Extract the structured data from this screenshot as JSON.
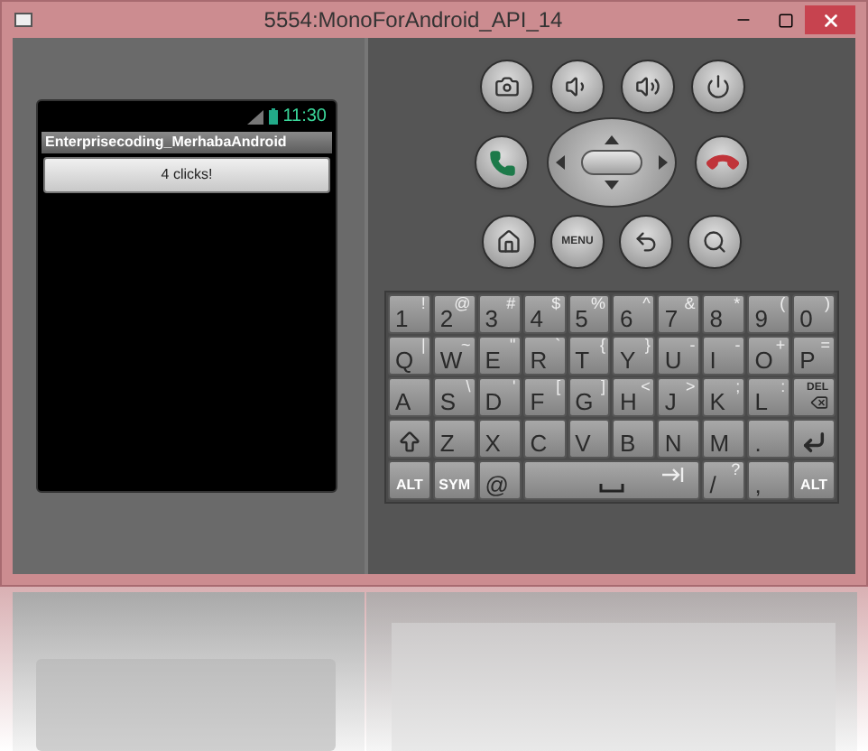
{
  "window": {
    "title": "5554:MonoForAndroid_API_14"
  },
  "phone": {
    "status_time": "11:30",
    "app_title": "Enterprisecoding_MerhabaAndroid",
    "button": "4 clicks!"
  },
  "hardware": {
    "menu_label": "MENU"
  },
  "keyboard": {
    "rows": [
      [
        {
          "kind": "char",
          "label": "1",
          "alt": "!"
        },
        {
          "kind": "char",
          "label": "2",
          "alt": "@"
        },
        {
          "kind": "char",
          "label": "3",
          "alt": "#"
        },
        {
          "kind": "char",
          "label": "4",
          "alt": "$"
        },
        {
          "kind": "char",
          "label": "5",
          "alt": "%"
        },
        {
          "kind": "char",
          "label": "6",
          "alt": "^"
        },
        {
          "kind": "char",
          "label": "7",
          "alt": "&"
        },
        {
          "kind": "char",
          "label": "8",
          "alt": "*"
        },
        {
          "kind": "char",
          "label": "9",
          "alt": "("
        },
        {
          "kind": "char",
          "label": "0",
          "alt": ")"
        }
      ],
      [
        {
          "kind": "char",
          "label": "Q",
          "alt": "|"
        },
        {
          "kind": "char",
          "label": "W",
          "alt": "~"
        },
        {
          "kind": "char",
          "label": "E",
          "alt": "\""
        },
        {
          "kind": "char",
          "label": "R",
          "alt": "`"
        },
        {
          "kind": "char",
          "label": "T",
          "alt": "{"
        },
        {
          "kind": "char",
          "label": "Y",
          "alt": "}"
        },
        {
          "kind": "char",
          "label": "U",
          "alt": "-"
        },
        {
          "kind": "char",
          "label": "I",
          "alt": "-"
        },
        {
          "kind": "char",
          "label": "O",
          "alt": "+"
        },
        {
          "kind": "char",
          "label": "P",
          "alt": "="
        }
      ],
      [
        {
          "kind": "char",
          "label": "A"
        },
        {
          "kind": "char",
          "label": "S",
          "alt": "\\"
        },
        {
          "kind": "char",
          "label": "D",
          "alt": "'"
        },
        {
          "kind": "char",
          "label": "F",
          "alt": "["
        },
        {
          "kind": "char",
          "label": "G",
          "alt": "]"
        },
        {
          "kind": "char",
          "label": "H",
          "alt": "<"
        },
        {
          "kind": "char",
          "label": "J",
          "alt": ">"
        },
        {
          "kind": "char",
          "label": "K",
          "alt": ";"
        },
        {
          "kind": "char",
          "label": "L",
          "alt": ":"
        },
        {
          "kind": "del",
          "label": "DEL"
        }
      ],
      [
        {
          "kind": "shift"
        },
        {
          "kind": "char",
          "label": "Z"
        },
        {
          "kind": "char",
          "label": "X"
        },
        {
          "kind": "char",
          "label": "C"
        },
        {
          "kind": "char",
          "label": "V"
        },
        {
          "kind": "char",
          "label": "B"
        },
        {
          "kind": "char",
          "label": "N"
        },
        {
          "kind": "char",
          "label": "M"
        },
        {
          "kind": "char",
          "label": "."
        },
        {
          "kind": "enter"
        }
      ]
    ],
    "bottom_row": [
      {
        "kind": "mod",
        "label": "ALT"
      },
      {
        "kind": "mod",
        "label": "SYM"
      },
      {
        "kind": "char",
        "label": "@"
      },
      {
        "kind": "space"
      },
      {
        "kind": "char",
        "label": "/",
        "alt": "?"
      },
      {
        "kind": "char",
        "label": ","
      },
      {
        "kind": "mod",
        "label": "ALT"
      }
    ]
  }
}
